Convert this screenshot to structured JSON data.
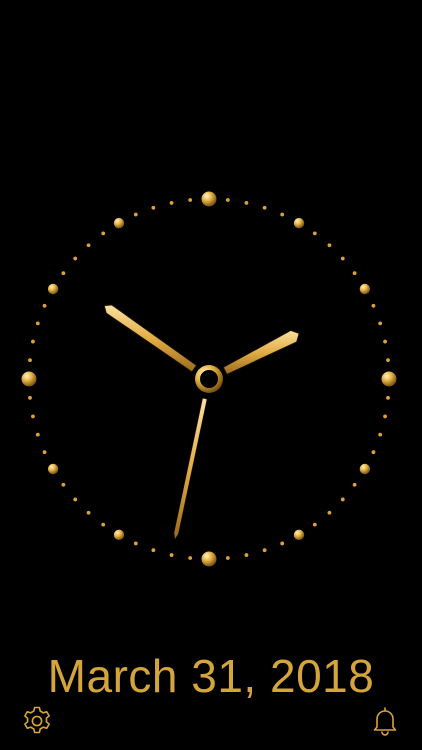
{
  "date_text": "March 31, 2018",
  "accent_color": "#d4a53a",
  "background_color": "#000000",
  "clock": {
    "hour": 10,
    "minute": 10,
    "second": 32
  },
  "icons": {
    "settings": "gear-icon",
    "alarm": "bell-icon"
  }
}
